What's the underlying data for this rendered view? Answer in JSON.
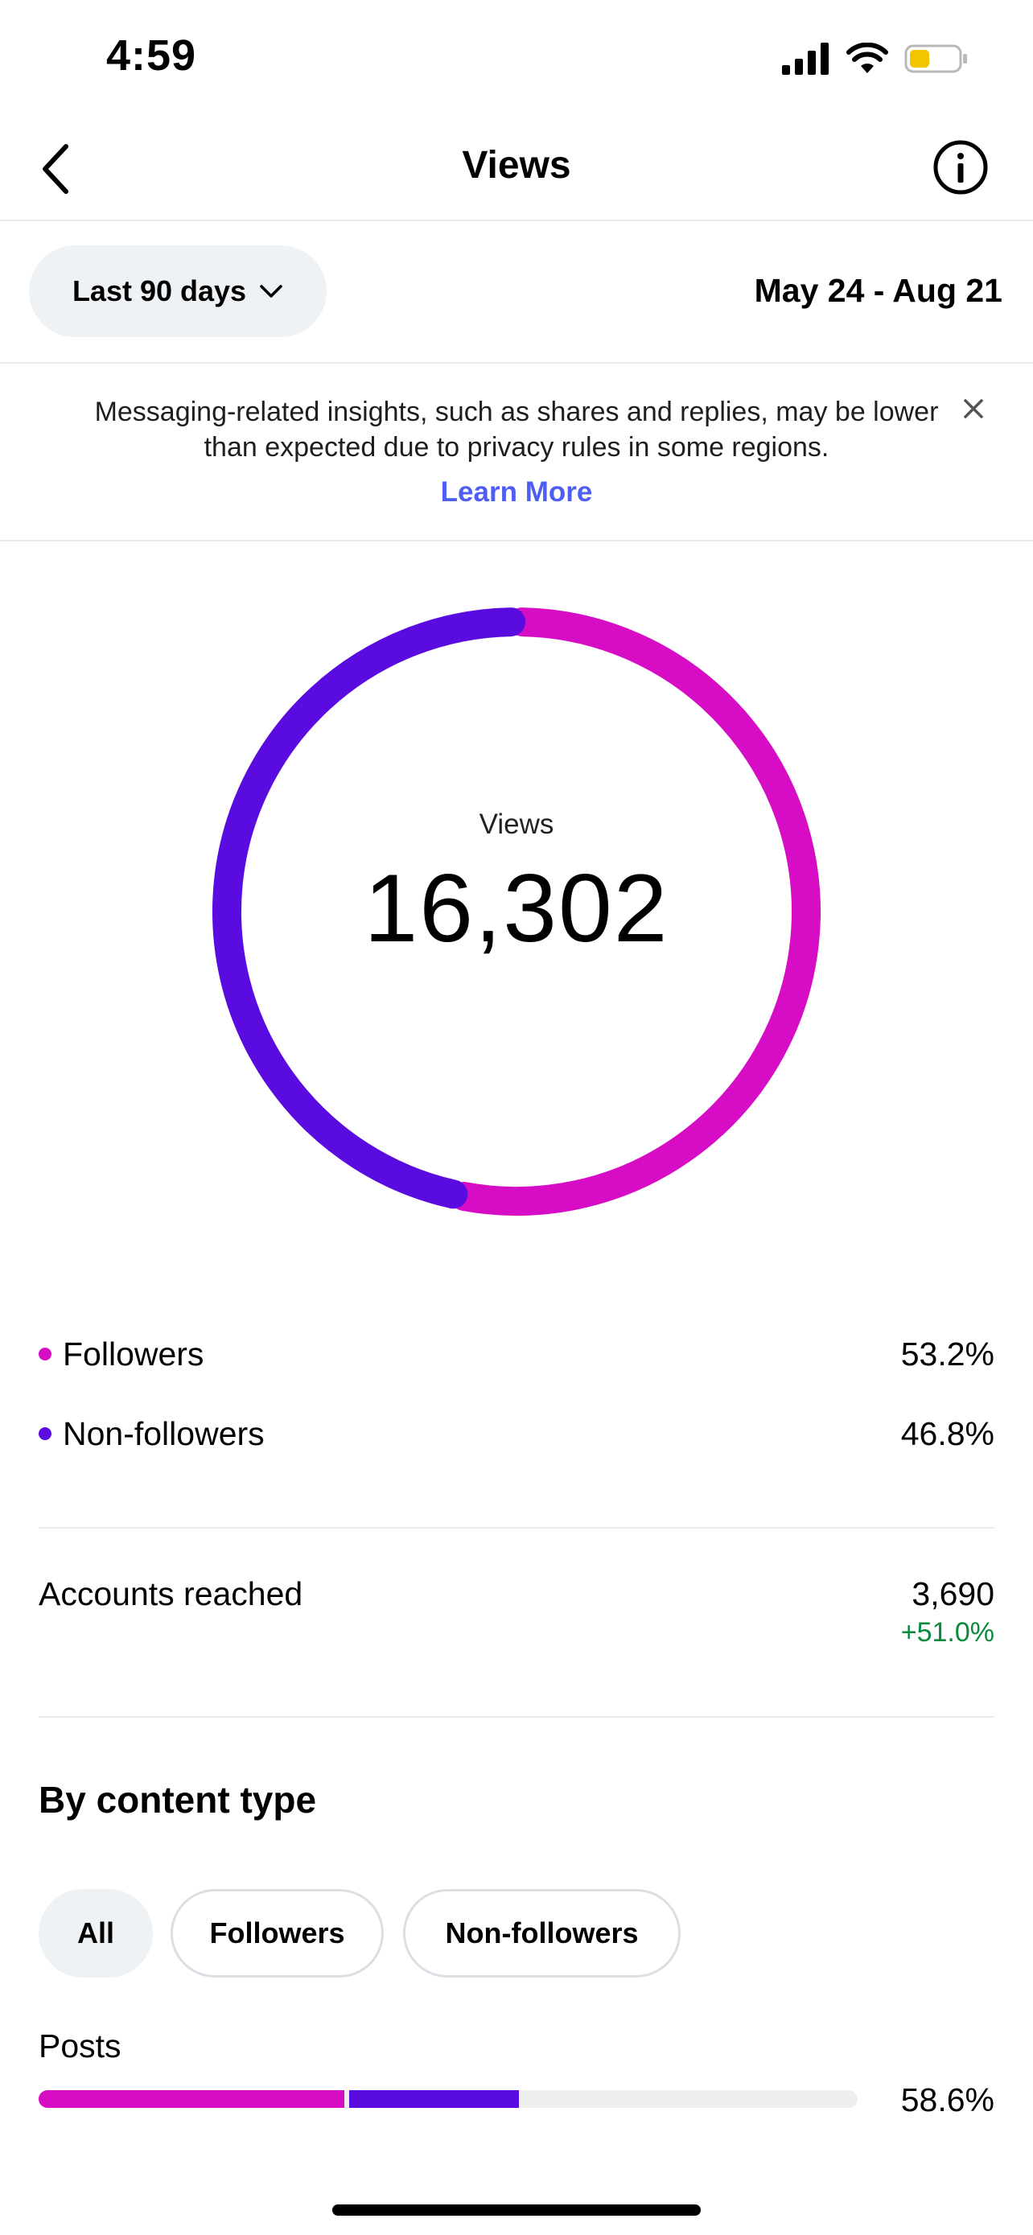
{
  "status_bar": {
    "time": "4:59"
  },
  "header": {
    "title": "Views",
    "back_icon": "chevron-left-icon",
    "info_icon": "info-icon"
  },
  "date_filter": {
    "period_label": "Last 90 days",
    "range": "May 24 - Aug 21"
  },
  "notice": {
    "text": "Messaging-related insights, such as shares and replies, may be lower than expected due to privacy rules in some regions.",
    "link": "Learn More"
  },
  "summary": {
    "label": "Views",
    "value": "16,302",
    "breakdown": [
      {
        "label": "Followers",
        "percent": "53.2%",
        "color": "#d70dc6"
      },
      {
        "label": "Non-followers",
        "percent": "46.8%",
        "color": "#5a0be0"
      }
    ]
  },
  "chart_data": {
    "type": "pie",
    "categories": [
      "Followers",
      "Non-followers"
    ],
    "values": [
      53.2,
      46.8
    ],
    "colors": [
      "#d70dc6",
      "#5a0be0"
    ]
  },
  "accounts_reached": {
    "label": "Accounts reached",
    "value": "3,690",
    "change": "+51.0%"
  },
  "content_type": {
    "title": "By content type",
    "filters": [
      "All",
      "Followers",
      "Non-followers"
    ],
    "selected": "All",
    "rows": [
      {
        "label": "Posts",
        "percent": "58.6%",
        "followers_share": 0.373,
        "non_followers_share": 0.213
      }
    ]
  }
}
